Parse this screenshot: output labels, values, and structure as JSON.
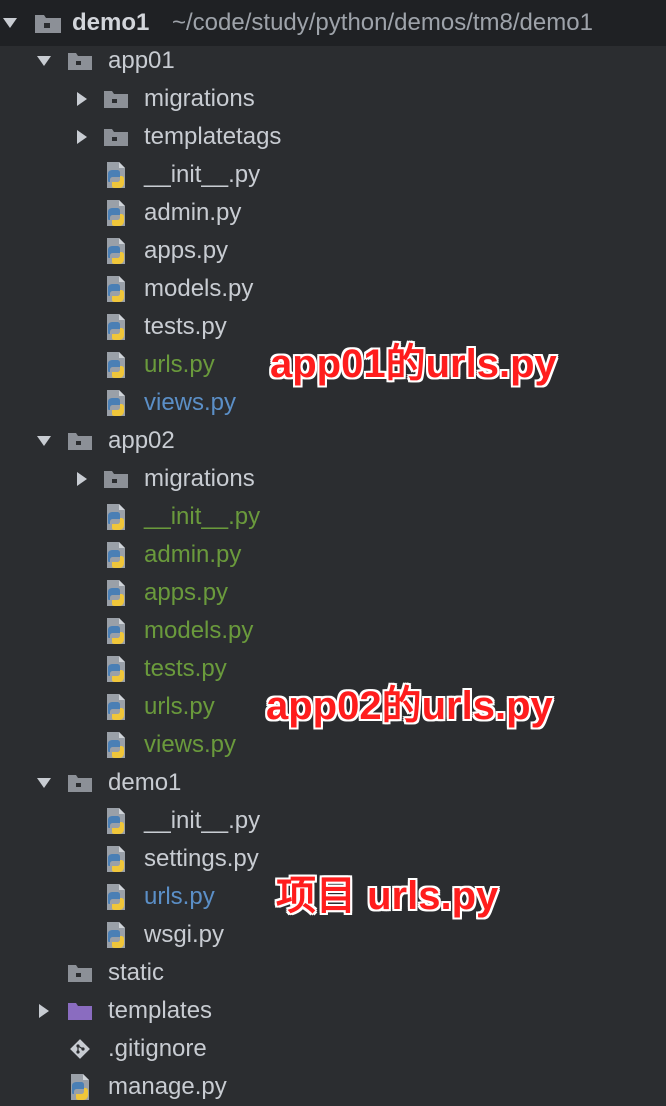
{
  "project_tree": {
    "root": {
      "name": "demo1",
      "path": "~/code/study/python/demos/tm8/demo1"
    },
    "rows": [
      {
        "label": "app01",
        "type": "folder",
        "arrow": "expanded",
        "depth": 1
      },
      {
        "label": "migrations",
        "type": "folder",
        "arrow": "collapsed",
        "depth": 2
      },
      {
        "label": "templatetags",
        "type": "folder",
        "arrow": "collapsed",
        "depth": 2
      },
      {
        "label": "__init__.py",
        "type": "python",
        "depth": 2,
        "color": "default"
      },
      {
        "label": "admin.py",
        "type": "python",
        "depth": 2,
        "color": "default"
      },
      {
        "label": "apps.py",
        "type": "python",
        "depth": 2,
        "color": "default"
      },
      {
        "label": "models.py",
        "type": "python",
        "depth": 2,
        "color": "default"
      },
      {
        "label": "tests.py",
        "type": "python",
        "depth": 2,
        "color": "default"
      },
      {
        "label": "urls.py",
        "type": "python",
        "depth": 2,
        "color": "green"
      },
      {
        "label": "views.py",
        "type": "python",
        "depth": 2,
        "color": "blue"
      },
      {
        "label": "app02",
        "type": "folder",
        "arrow": "expanded",
        "depth": 1
      },
      {
        "label": "migrations",
        "type": "folder",
        "arrow": "collapsed",
        "depth": 2
      },
      {
        "label": "__init__.py",
        "type": "python",
        "depth": 2,
        "color": "green"
      },
      {
        "label": "admin.py",
        "type": "python",
        "depth": 2,
        "color": "green"
      },
      {
        "label": "apps.py",
        "type": "python",
        "depth": 2,
        "color": "green"
      },
      {
        "label": "models.py",
        "type": "python",
        "depth": 2,
        "color": "green"
      },
      {
        "label": "tests.py",
        "type": "python",
        "depth": 2,
        "color": "green"
      },
      {
        "label": "urls.py",
        "type": "python",
        "depth": 2,
        "color": "green"
      },
      {
        "label": "views.py",
        "type": "python",
        "depth": 2,
        "color": "green"
      },
      {
        "label": "demo1",
        "type": "folder",
        "arrow": "expanded",
        "depth": 1
      },
      {
        "label": "__init__.py",
        "type": "python",
        "depth": 2,
        "color": "default"
      },
      {
        "label": "settings.py",
        "type": "python",
        "depth": 2,
        "color": "default"
      },
      {
        "label": "urls.py",
        "type": "python",
        "depth": 2,
        "color": "blue"
      },
      {
        "label": "wsgi.py",
        "type": "python",
        "depth": 2,
        "color": "default"
      },
      {
        "label": "static",
        "type": "folder",
        "arrow": "none",
        "depth": 1
      },
      {
        "label": "templates",
        "type": "folder-purple",
        "arrow": "collapsed",
        "depth": 1
      },
      {
        "label": ".gitignore",
        "type": "git",
        "depth": 1,
        "color": "default"
      },
      {
        "label": "manage.py",
        "type": "python",
        "depth": 1,
        "color": "default"
      }
    ]
  },
  "annotations": [
    {
      "text": "app01的urls.py",
      "target_row": 8
    },
    {
      "text": "app02的urls.py",
      "target_row": 17
    },
    {
      "text": "项目 urls.py",
      "target_row": 22
    }
  ],
  "colors": {
    "background": "#2b2d30",
    "root_background": "#1f2124",
    "text_default": "#c8ccd2",
    "text_modified_green": "#6a9a3c",
    "text_modified_blue": "#5b8fc7",
    "folder_gray": "#8c9097",
    "folder_purple": "#8a6cc0",
    "annotation_red": "#ff1d1d"
  }
}
